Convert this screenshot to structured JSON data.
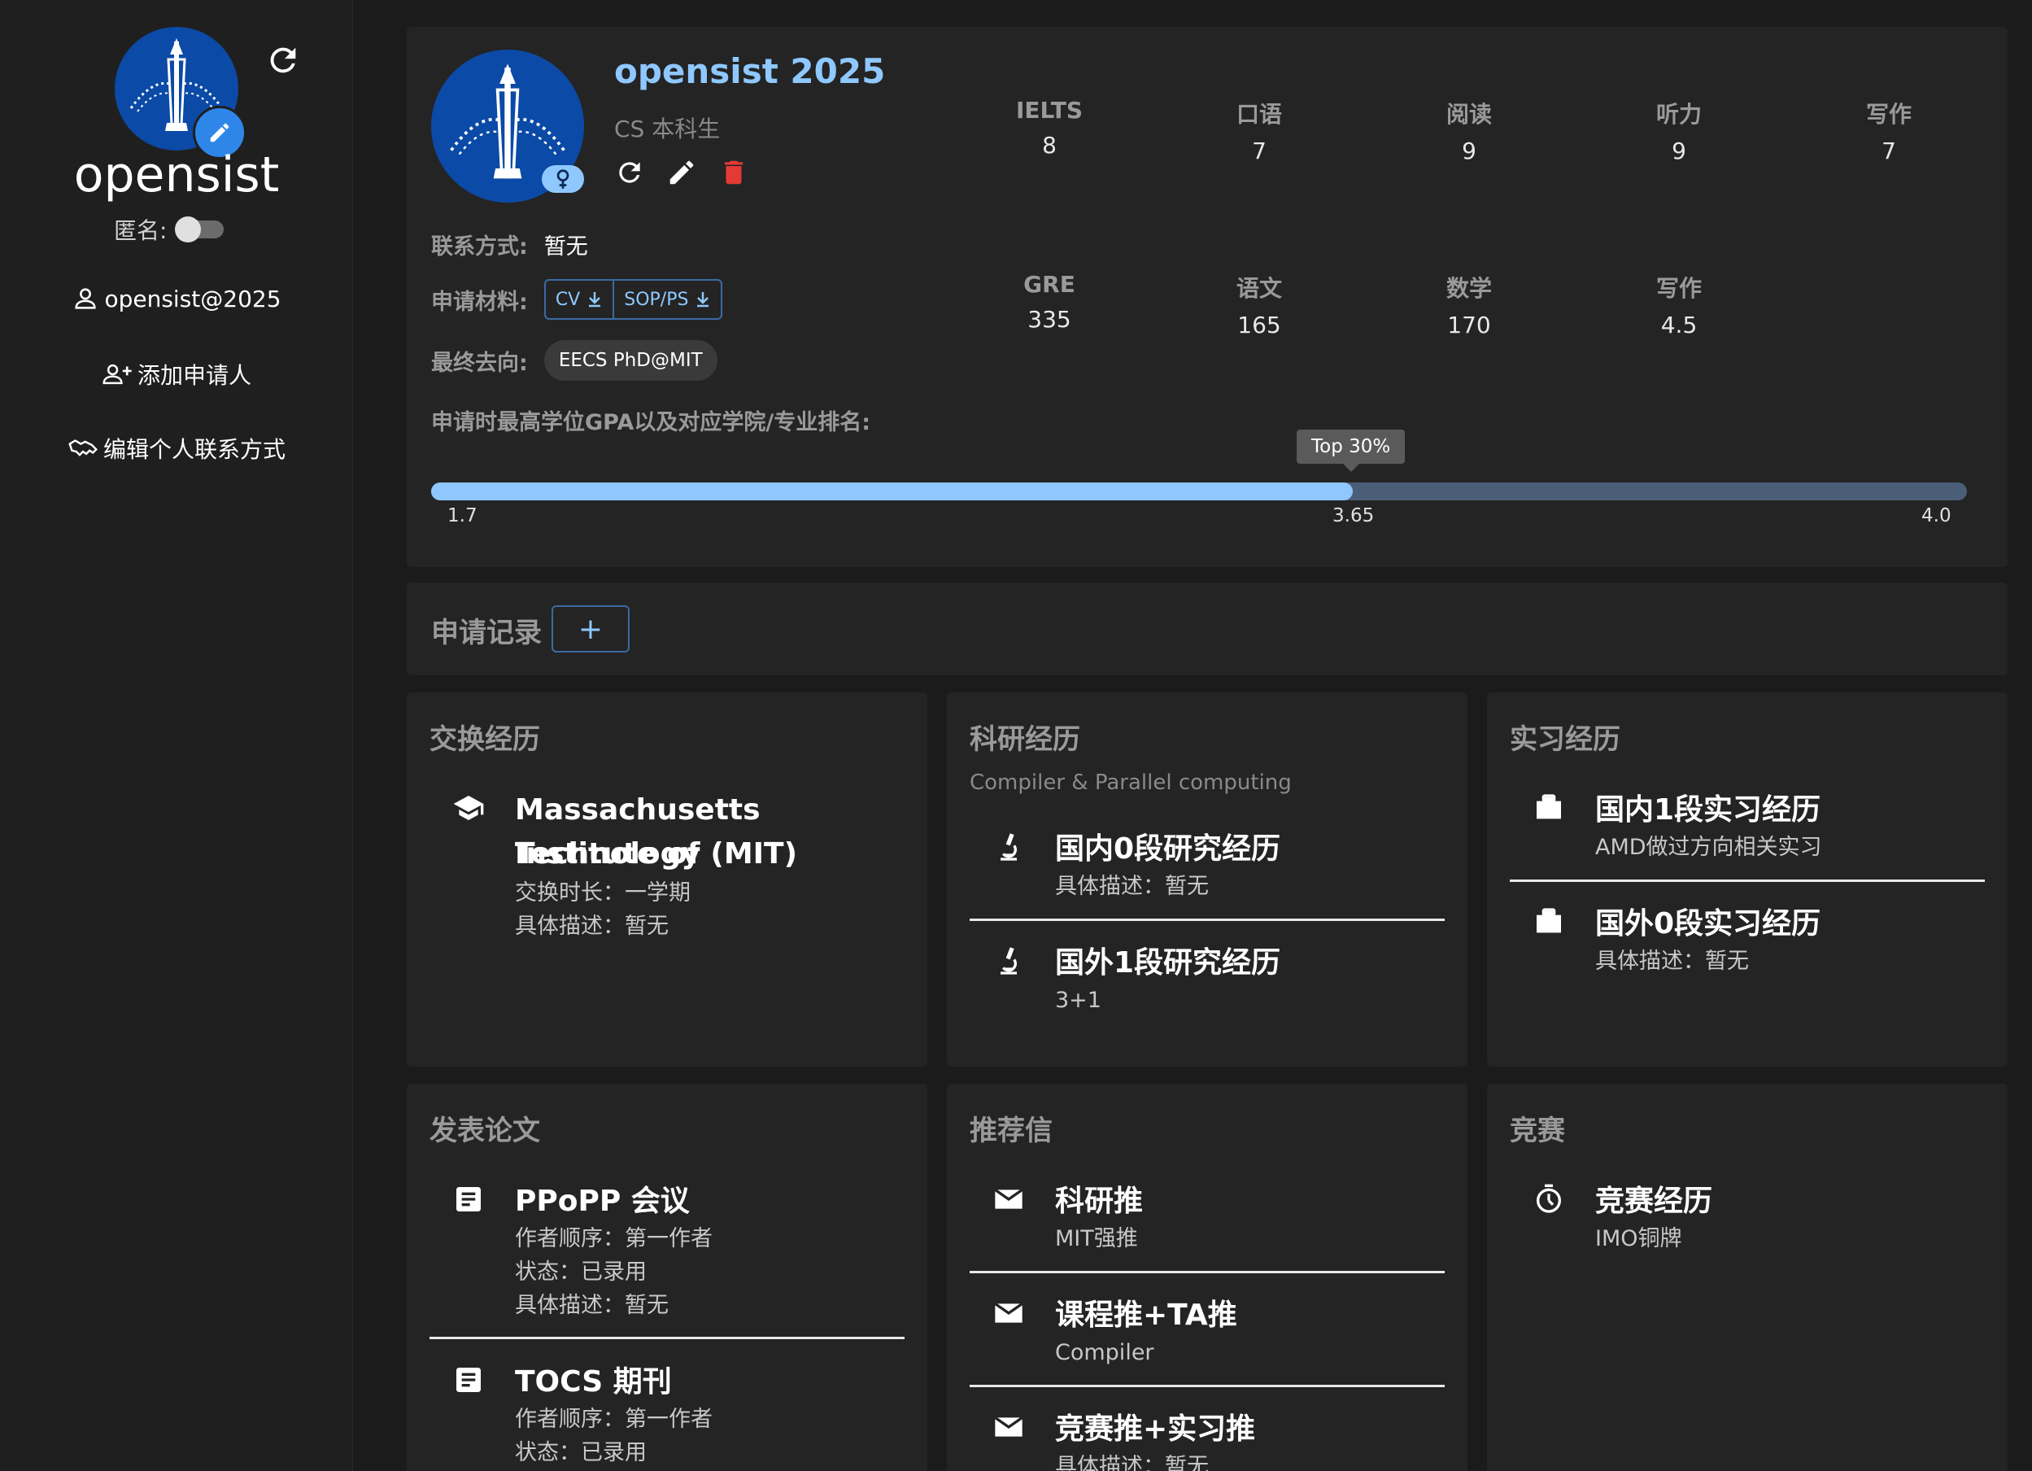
{
  "sidebar": {
    "name": "opensist",
    "anon_label": "匿名:",
    "anon_on": false,
    "email": "opensist@2025",
    "add_applicant": "添加申请人",
    "edit_contact": "编辑个人联系方式"
  },
  "profile": {
    "title": "opensist 2025",
    "subtitle": "CS 本科生",
    "contact_label": "联系方式:",
    "contact_value": "暂无",
    "materials_label": "申请材料:",
    "material_cv": "CV",
    "material_sop": "SOP/PS",
    "destination_label": "最终去向:",
    "destination_value": "EECS PhD@MIT",
    "gpa_label": "申请时最高学位GPA以及对应学院/专业排名:",
    "gpa_min": "1.7",
    "gpa_value": "3.65",
    "gpa_max": "4.0",
    "gpa_fraction": 0.6,
    "rank_tooltip": "Top 30%"
  },
  "scores": {
    "ielts": [
      {
        "label": "IELTS",
        "value": "8"
      },
      {
        "label": "口语",
        "value": "7"
      },
      {
        "label": "阅读",
        "value": "9"
      },
      {
        "label": "听力",
        "value": "9"
      },
      {
        "label": "写作",
        "value": "7"
      }
    ],
    "gre": [
      {
        "label": "GRE",
        "value": "335"
      },
      {
        "label": "语文",
        "value": "165"
      },
      {
        "label": "数学",
        "value": "170"
      },
      {
        "label": "写作",
        "value": "4.5"
      }
    ]
  },
  "records": {
    "title": "申请记录",
    "add": "+"
  },
  "exchange": {
    "title": "交换经历",
    "school_line1": "Massachusetts Institute of",
    "school_line2": "Technology (MIT)",
    "duration": "交换时长：一学期",
    "desc": "具体描述：暂无"
  },
  "research": {
    "title": "科研经历",
    "subtitle": "Compiler & Parallel computing",
    "items": [
      {
        "title": "国内0段研究经历",
        "desc": "具体描述：暂无"
      },
      {
        "title": "国外1段研究经历",
        "desc": "3+1"
      }
    ]
  },
  "intern": {
    "title": "实习经历",
    "items": [
      {
        "title": "国内1段实习经历",
        "desc": "AMD做过方向相关实习"
      },
      {
        "title": "国外0段实习经历",
        "desc": "具体描述：暂无"
      }
    ]
  },
  "papers": {
    "title": "发表论文",
    "items": [
      {
        "title": "PPoPP 会议",
        "author": "作者顺序：第一作者",
        "status": "状态：已录用",
        "desc": "具体描述：暂无"
      },
      {
        "title": "TOCS 期刊",
        "author": "作者顺序：第一作者",
        "status": "状态：已录用"
      }
    ]
  },
  "recommend": {
    "title": "推荐信",
    "items": [
      {
        "title": "科研推",
        "desc": "MIT强推"
      },
      {
        "title": "课程推+TA推",
        "desc": "Compiler"
      },
      {
        "title": "竞赛推+实习推",
        "desc": "具体描述：暂无"
      }
    ]
  },
  "competition": {
    "title": "竞赛",
    "items": [
      {
        "title": "竞赛经历",
        "desc": "IMO铜牌"
      }
    ]
  }
}
